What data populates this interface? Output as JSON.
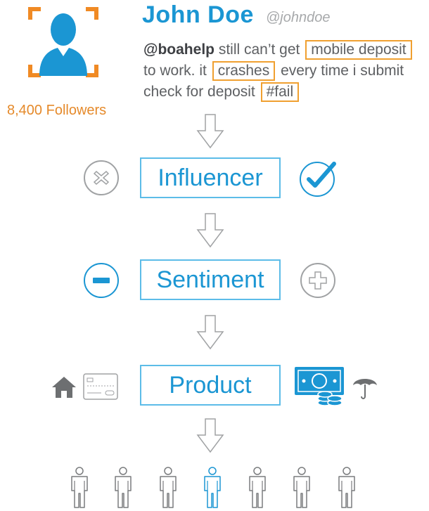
{
  "profile": {
    "name": "John Doe",
    "handle": "@johndoe",
    "followers": "8,400 Followers"
  },
  "tweet": {
    "mention": "@boahelp",
    "part1": " still can’t get ",
    "highlight1": "mobile deposit",
    "part2": " to work. it ",
    "highlight2": "crashes",
    "part3": " every time i submit check for deposit ",
    "highlight3": "#fail"
  },
  "stages": {
    "influencer": "Influencer",
    "sentiment": "Sentiment",
    "product": "Product"
  },
  "colors": {
    "accent_blue": "#1b96d3",
    "orange": "#f0a030",
    "gray": "#6d6f71"
  },
  "icons": [
    "user-avatar-icon",
    "x-circle-icon",
    "check-circle-icon",
    "minus-circle-icon",
    "plus-circle-icon",
    "house-icon",
    "credit-card-icon",
    "money-coins-icon",
    "umbrella-icon",
    "person-icon"
  ]
}
